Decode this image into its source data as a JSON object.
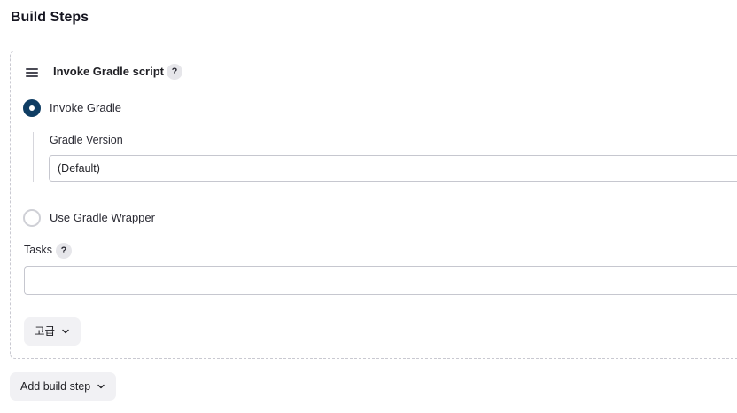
{
  "section": {
    "title": "Build Steps"
  },
  "step": {
    "title": "Invoke Gradle script",
    "help_label": "?",
    "options": [
      {
        "label": "Invoke Gradle",
        "selected": true
      },
      {
        "label": "Use Gradle Wrapper",
        "selected": false
      }
    ],
    "gradle_version": {
      "label": "Gradle Version",
      "value": "(Default)"
    },
    "tasks": {
      "label": "Tasks",
      "help_label": "?",
      "value": ""
    },
    "advanced_button": "고급"
  },
  "add_build_step_button": "Add build step",
  "colors": {
    "radio_selected": "#0f3d63",
    "button_bg": "#f1f1f4"
  }
}
